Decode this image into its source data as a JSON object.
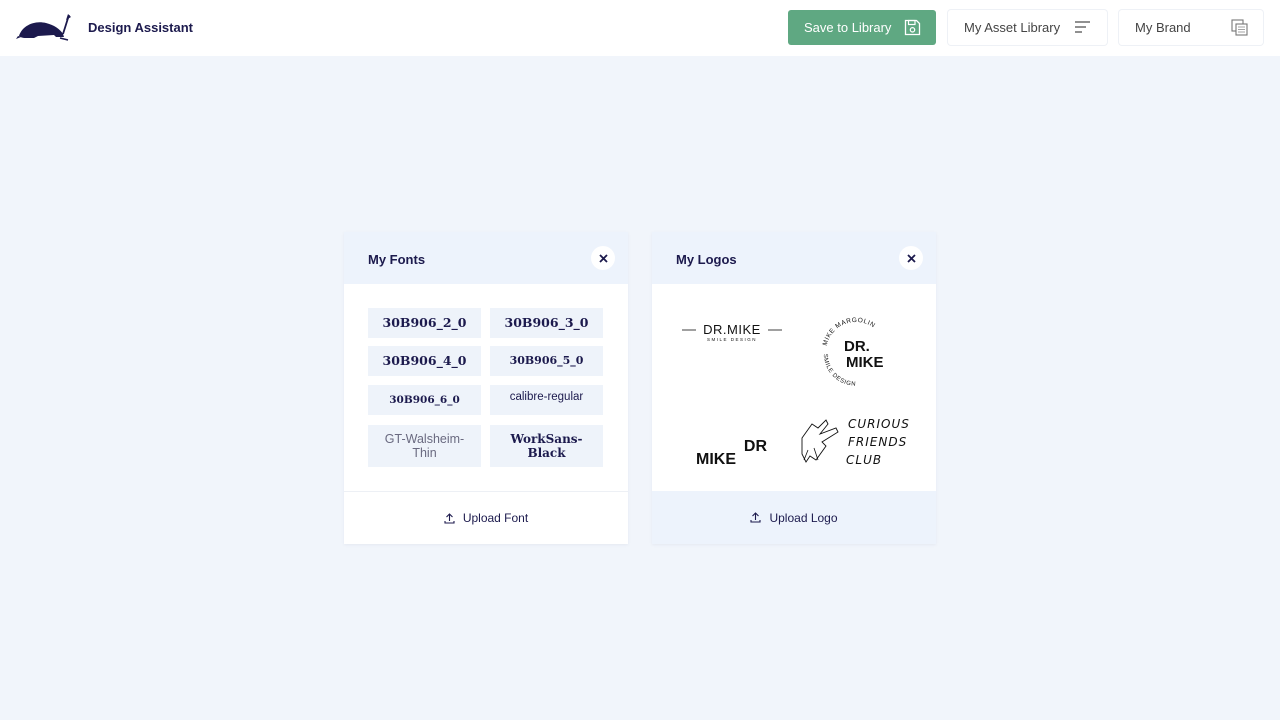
{
  "app": {
    "title": "Design Assistant",
    "logo_icon": "armadillo-logo-icon"
  },
  "header": {
    "save_label": "Save to Library",
    "asset_library_label": "My Asset Library",
    "brand_label": "My Brand"
  },
  "colors": {
    "accent_green": "#5fa882",
    "navy": "#1c1a4d",
    "background": "#f1f5fb"
  },
  "fonts_panel": {
    "title": "My Fonts",
    "fonts": [
      "30B906_2_0",
      "30B906_3_0",
      "30B906_4_0",
      "30B906_5_0",
      "30B906_6_0",
      "calibre-regular",
      "GT-Walsheim-Thin",
      "WorkSans-Black"
    ],
    "upload_label": "Upload Font"
  },
  "logos_panel": {
    "title": "My Logos",
    "logos": [
      "DR.MIKE SMILE DESIGN",
      "MIKE MARGOLIN DR. MIKE SMILE DESIGN",
      "DR MIKE",
      "CURIOUS FRIENDS CLUB"
    ],
    "upload_label": "Upload Logo"
  }
}
